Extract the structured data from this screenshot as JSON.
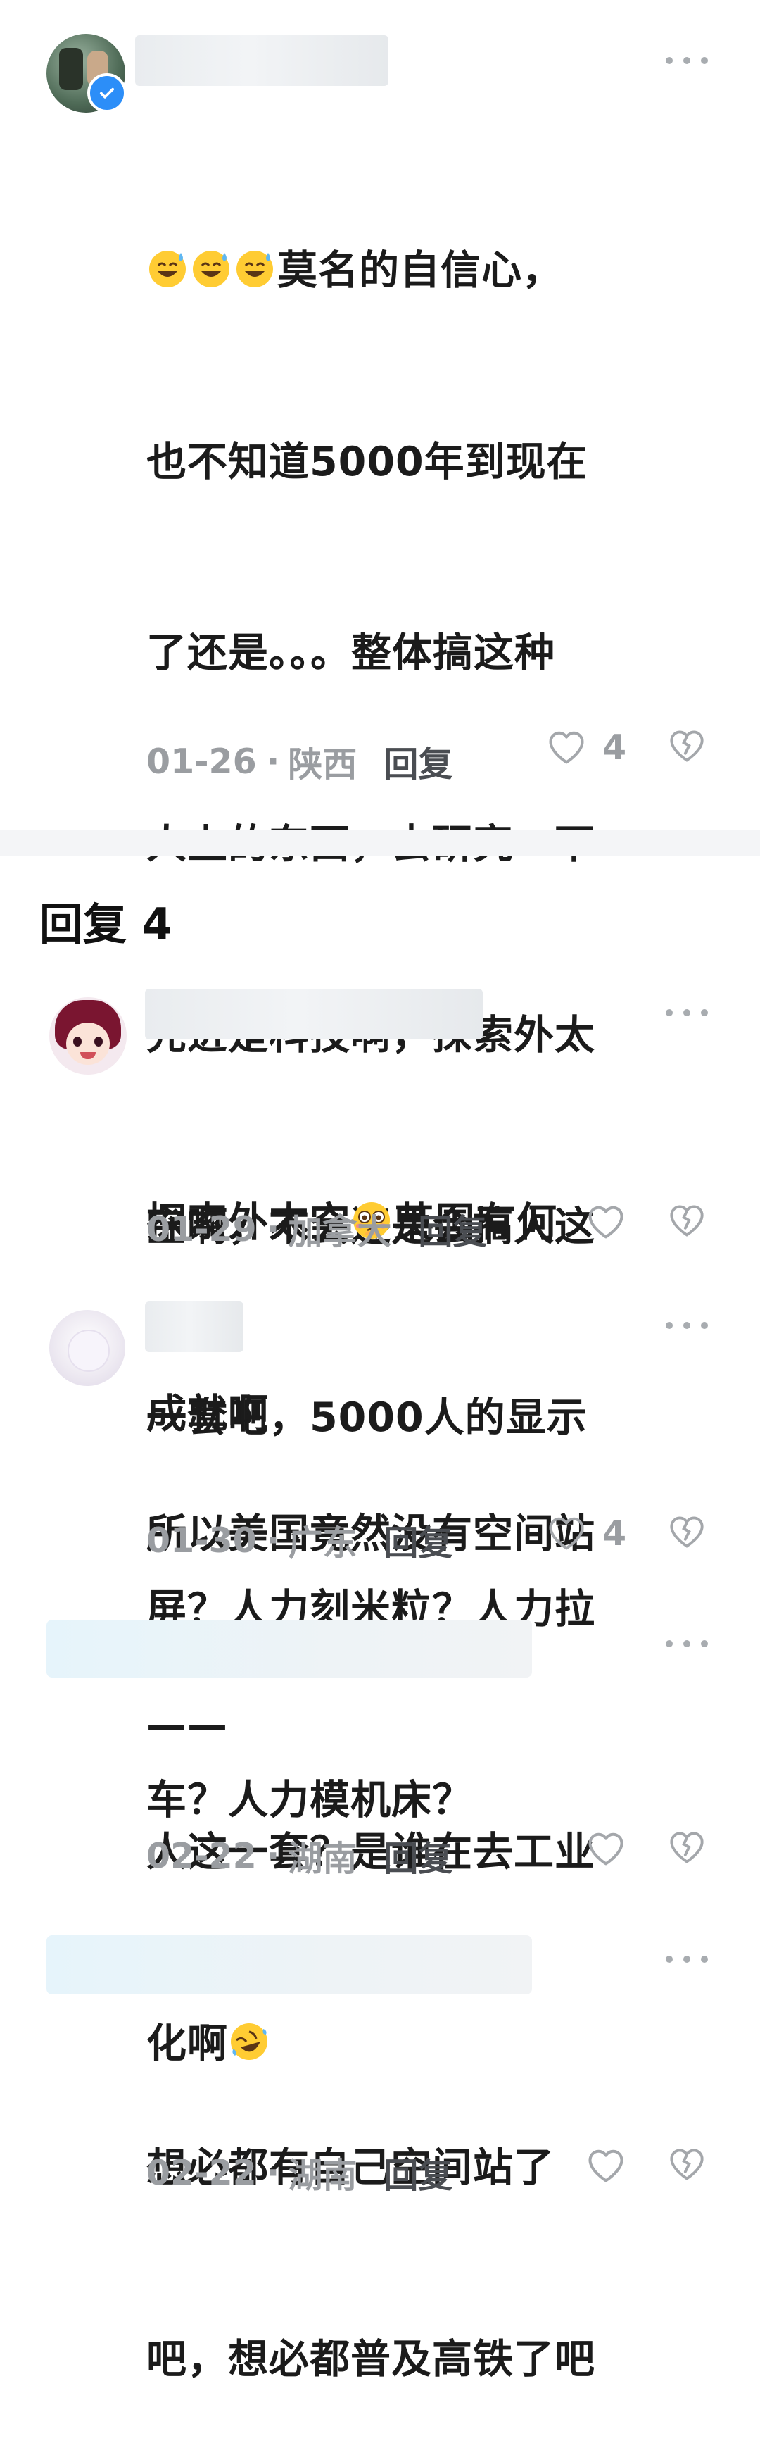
{
  "comments": [
    {
      "lines": [
        "莫名的自信心，",
        "也不知道5000年到现在",
        "了还是。。。整体搞这种",
        "人上的东西，去研究一下",
        "先进是科技啊，探索外太",
        "空啊，不会还是会搞人这",
        "一套吧，5000人的显示",
        "屏？人力刻米粒？人力拉",
        "车？人力模机床？"
      ],
      "emoji_prefix": [
        "sweat-smile-emoji",
        "sweat-smile-emoji",
        "sweat-smile-emoji"
      ],
      "date": "01-26",
      "location": "陕西",
      "reply_label": "回复",
      "likes": "4"
    }
  ],
  "section": {
    "title": "回复 4"
  },
  "replies": [
    {
      "lines": [
        "探索外太空",
        "英国有何",
        "成就啊"
      ],
      "date": "01-29",
      "location": "加拿大",
      "reply_label": "回复",
      "likes": ""
    },
    {
      "lines": [
        "所以美国竟然没有空间站",
        "——"
      ],
      "date": "01-30",
      "location": "广东",
      "reply_label": "回复",
      "likes": "4"
    },
    {
      "lines": [
        "人这一套？是谁在去工业",
        "化啊"
      ],
      "date": "02-22",
      "location": "湖南",
      "reply_label": "回复",
      "likes": ""
    },
    {
      "lines": [
        "想必都有自己空间站了",
        "吧，想必都普及高铁了吧"
      ],
      "date": "02-22",
      "location": "湖南",
      "reply_label": "回复",
      "likes": ""
    }
  ],
  "colors": {
    "meta": "#9a9da1",
    "text": "#1b1b1b",
    "divider": "#f4f5f7",
    "verified": "#2c8ef8"
  },
  "meta_separator": "·"
}
